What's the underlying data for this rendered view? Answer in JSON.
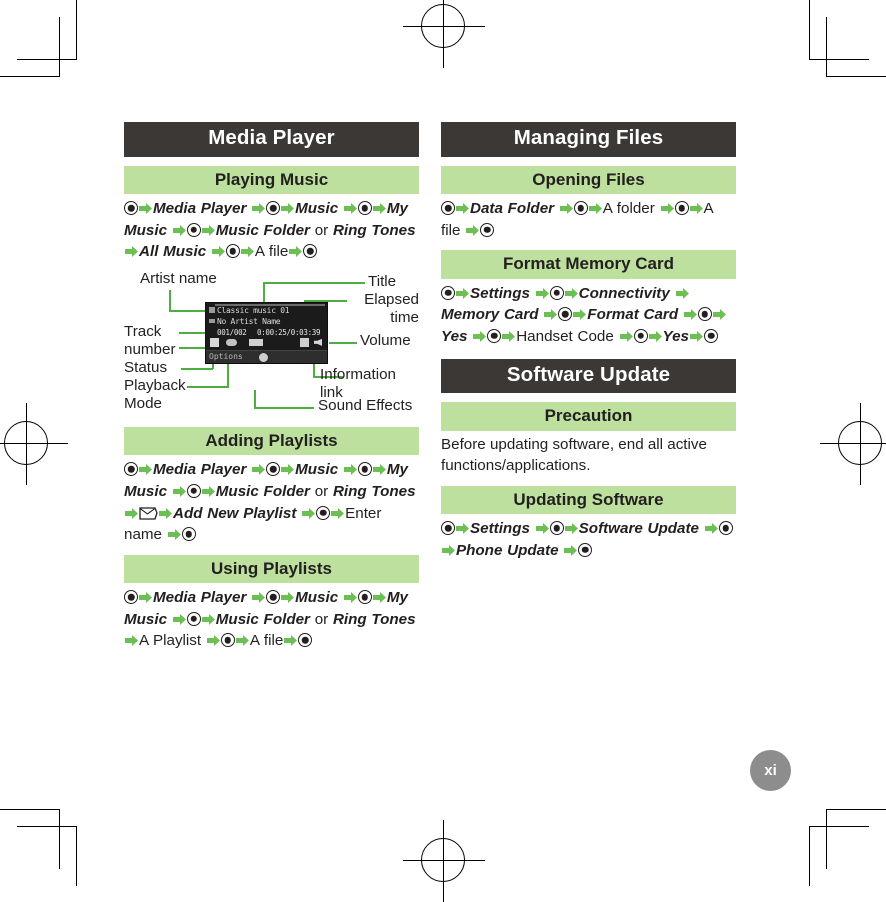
{
  "page": {
    "number_label": "xi",
    "print_marks": "crop-and-registration"
  },
  "left_column": {
    "chapter": "Media Player",
    "sections": [
      {
        "heading": "Playing Music",
        "type": "steps",
        "tokens": [
          {
            "t": "key"
          },
          {
            "t": "arrow"
          },
          {
            "t": "em",
            "v": "Media Player"
          },
          {
            "t": "arrow"
          },
          {
            "t": "key"
          },
          {
            "t": "arrow"
          },
          {
            "t": "em",
            "v": "Music"
          },
          {
            "t": "arrow"
          },
          {
            "t": "key"
          },
          {
            "t": "arrow"
          },
          {
            "t": "em",
            "v": "My Music"
          },
          {
            "t": "arrow"
          },
          {
            "t": "key"
          },
          {
            "t": "arrow"
          },
          {
            "t": "em",
            "v": "Music Folder"
          },
          {
            "t": "plain",
            "v": "or"
          },
          {
            "t": "em",
            "v": "Ring Tones"
          },
          {
            "t": "arrow"
          },
          {
            "t": "em",
            "v": "All Music"
          },
          {
            "t": "arrow"
          },
          {
            "t": "key"
          },
          {
            "t": "arrow"
          },
          {
            "t": "plain",
            "v": "A file"
          },
          {
            "t": "arrow"
          },
          {
            "t": "key"
          }
        ],
        "raw_text": "◉➔ Media Player ➔◉➔ Music ➔◉➔ My Music ➔◉➔ Music Folder or Ring Tones ➔ All Music ➔◉➔ A file➔◉"
      },
      {
        "heading": "Adding Playlists",
        "type": "steps",
        "raw_text": "◉➔ Media Player ➔◉➔ Music ➔◉➔ My Music ➔◉➔ Music Folder or Ring Tones ➔✉➔ Add New Playlist ➔◉➔ Enter name ➔◉"
      },
      {
        "heading": "Using Playlists",
        "type": "steps",
        "raw_text": "◉➔ Media Player ➔◉➔ Music ➔◉➔ My Music ➔◉➔ Music Folder or Ring Tones ➔ A Playlist ➔◉➔ A file➔◉"
      }
    ],
    "labels": {
      "step_words": {
        "media_player": "Media Player",
        "music": "Music",
        "my_music": "My Music",
        "music_folder": "Music Folder",
        "or": "or",
        "ring_tones": "Ring Tones",
        "all_music": "All Music",
        "a_file": "A file",
        "add_new_playlist": "Add New Playlist",
        "enter_name": "Enter name",
        "a_playlist": "A Playlist"
      }
    }
  },
  "diagram": {
    "name": "media-player-screen-callouts",
    "callouts": {
      "artist_name": "Artist name",
      "track_number": "Track\nnumber",
      "status": "Status",
      "playback_mode": "Playback\nMode",
      "title": "Title",
      "elapsed_time": "Elapsed\ntime",
      "volume": "Volume",
      "information_link": "Information link",
      "sound_effects": "Sound Effects"
    },
    "screen": {
      "track_title": "Classic music 01",
      "artist": "No Artist Name",
      "track_counter": "001/002",
      "time": "0:00:25/0:03:39",
      "options_label": "Options"
    }
  },
  "right_column": {
    "chapters": [
      {
        "chapter": "Managing Files",
        "sections": [
          {
            "heading": "Opening Files",
            "type": "steps",
            "raw_text": "◉➔ Data Folder ➔◉➔ A folder ➔◉➔ A file ➔◉",
            "words": {
              "data_folder": "Data Folder",
              "a_folder": "A folder",
              "a_file": "A file"
            }
          },
          {
            "heading": "Format Memory Card",
            "type": "steps",
            "raw_text": "◉➔ Settings ➔◉➔ Connectivity ➔ Memory Card ➔◉➔ Format Card ➔◉➔ Yes ➔◉➔ Handset Code ➔◉➔ Yes➔◉",
            "words": {
              "settings": "Settings",
              "connectivity": "Connectivity",
              "memory_card": "Memory Card",
              "format_card": "Format Card",
              "yes": "Yes",
              "handset_code": "Handset Code",
              "yes2": "Yes"
            }
          }
        ]
      },
      {
        "chapter": "Software Update",
        "sections": [
          {
            "heading": "Precaution",
            "type": "body",
            "body": "Before updating software, end all active functions/applications."
          },
          {
            "heading": "Updating Software",
            "type": "steps",
            "raw_text": "◉➔ Settings ➔◉➔ Software Update ➔◉➔ Phone Update ➔◉",
            "words": {
              "settings": "Settings",
              "software_update": "Software Update",
              "phone_update": "Phone Update"
            }
          }
        ]
      }
    ]
  },
  "colors": {
    "chapter_bar": "#3b3836",
    "section_bar": "#bde09e",
    "arrow_green": "#6cbf53",
    "leader_green": "#4caf3f",
    "text": "#231f1e",
    "page_badge": "#8d8d8d"
  }
}
